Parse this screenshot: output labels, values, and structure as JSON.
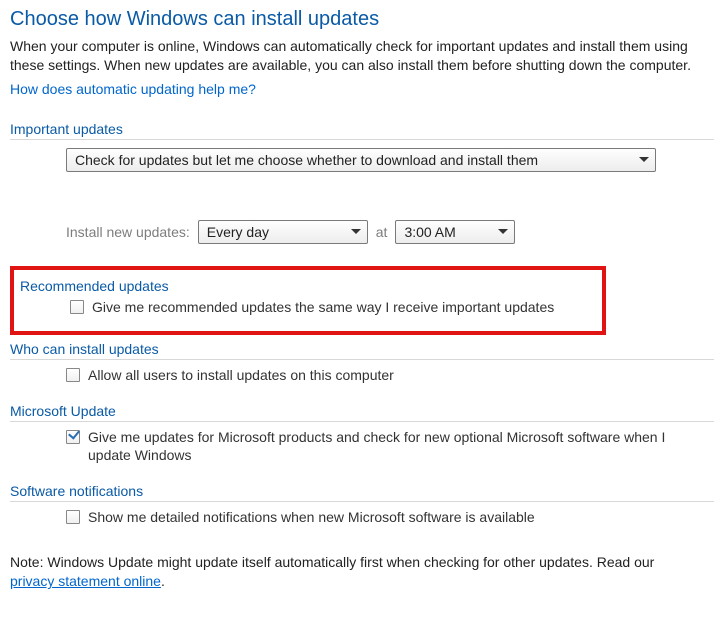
{
  "title": "Choose how Windows can install updates",
  "intro": "When your computer is online, Windows can automatically check for important updates and install them using these settings. When new updates are available, you can also install them before shutting down the computer.",
  "help_link": "How does automatic updating help me?",
  "important": {
    "label": "Important updates",
    "dropdown_value": "Check for updates but let me choose whether to download and install them",
    "schedule_label": "Install new updates:",
    "frequency": "Every day",
    "at_label": "at",
    "time": "3:00 AM"
  },
  "recommended": {
    "label": "Recommended updates",
    "cb_label": "Give me recommended updates the same way I receive important updates",
    "cb_checked": false
  },
  "who": {
    "label": "Who can install updates",
    "cb_label": "Allow all users to install updates on this computer",
    "cb_checked": false
  },
  "msupdate": {
    "label": "Microsoft Update",
    "cb_label": "Give me updates for Microsoft products and check for new optional Microsoft software when I update Windows",
    "cb_checked": true
  },
  "notifications": {
    "label": "Software notifications",
    "cb_label": "Show me detailed notifications when new Microsoft software is available",
    "cb_checked": false
  },
  "note_prefix": "Note: Windows Update might update itself automatically first when checking for other updates.  Read our ",
  "note_link": "privacy statement online",
  "note_suffix": "."
}
